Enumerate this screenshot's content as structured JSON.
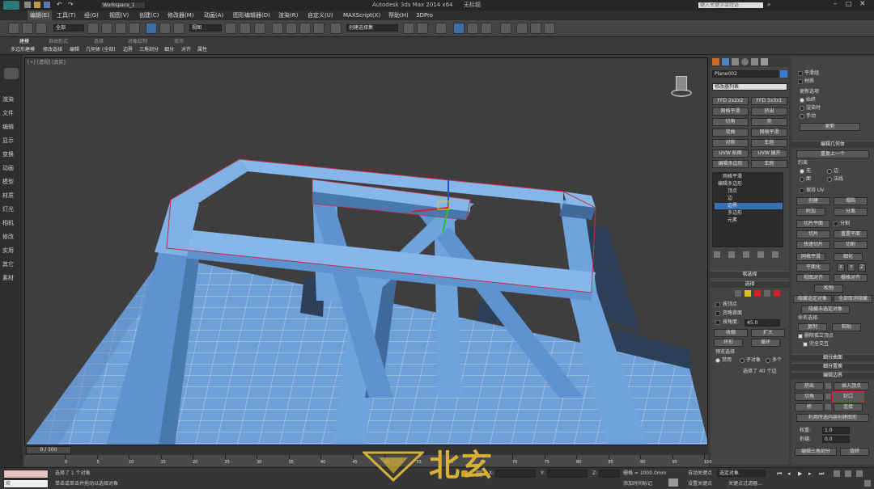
{
  "app": {
    "workspace": "Workspace_1",
    "title": "Autodesk 3ds Max 2014 x64",
    "filename": "无标题",
    "search_placeholder": "键入关键字或短语"
  },
  "menu": [
    "编辑(E)",
    "工具(T)",
    "组(G)",
    "视图(V)",
    "创建(C)",
    "修改器(M)",
    "动画(A)",
    "图形编辑器(D)",
    "渲染(R)",
    "自定义(U)",
    "MAXScript(X)",
    "帮助(H)",
    "3DPro"
  ],
  "toolbar": {
    "selection_filter": "全部",
    "view_dropdown": "视图",
    "named_selection": "创建选择集"
  },
  "ribbon": {
    "tabs": [
      "建模",
      "自由形式",
      "选择",
      "对象绘制",
      "填充"
    ],
    "subtabs": [
      "多边形建模",
      "修改选择",
      "编辑",
      "几何体 (全部)",
      "边界",
      "三角剖分",
      "细分",
      "对齐",
      "属性"
    ]
  },
  "command_bar": [
    "渲染",
    "文件",
    "编辑",
    "显示",
    "变换",
    "动画",
    "模型",
    "材质",
    "灯光",
    "相机",
    "修改",
    "实用",
    "其它",
    "素材"
  ],
  "viewport": {
    "label": "[+] [透视] [真实]"
  },
  "panel": {
    "object_name": "Plane002",
    "modifier_list": "修改器列表",
    "modifier_buttons": [
      "FFD 2x2x2",
      "FFD 3x3x1",
      "网格平滑",
      "挤出",
      "切角",
      "壳",
      "弯曲",
      "网格平滑",
      "对称",
      "车削",
      "UVW 贴图",
      "UVW 展开",
      "编辑多边形",
      "车削"
    ],
    "stack": [
      "网格平滑",
      "编辑多边形",
      "顶点",
      "边",
      "边界",
      "多边形",
      "元素"
    ],
    "soft_selection": "软选择",
    "selection_title": "选择",
    "by_vertex": "按顶点",
    "ignore_backfacing": "忽略背面",
    "by_angle": "按角度:",
    "angle_value": "45.0",
    "shrink": "收缩",
    "grow": "扩大",
    "ring": "环形",
    "loop": "循环",
    "preview_title": "预览选择",
    "preview_options": [
      "禁用",
      "子对象",
      "多个"
    ],
    "selection_status": "选择了 40 个边"
  },
  "panel2": {
    "smooth_group": "平滑组",
    "material_id": "材质",
    "update_title": "更新选项",
    "update_options": [
      "始终",
      "渲染时",
      "手动"
    ],
    "update_button": "更新",
    "edit_geometry": "编辑几何体",
    "repeat_last": "重复上一个",
    "constraint_title": "约束",
    "constraints": [
      "无",
      "边",
      "面",
      "法线"
    ],
    "keep_uv": "保持 UV",
    "create": "创建",
    "collapse": "塌陷",
    "attach": "附加",
    "detach": "分离",
    "slice_plane": "切片平面",
    "split": "分割",
    "slice": "切片",
    "reset_plane": "重置平面",
    "quick_slice": "快速切片",
    "cut": "切割",
    "meshsmooth": "网格平滑",
    "tessellate": "细化",
    "planarize": "平面化",
    "xyz": [
      "X",
      "Y",
      "Z"
    ],
    "view_align": "视图对齐",
    "grid_align": "栅格对齐",
    "relax": "松弛",
    "hide_selected": "隐藏选定对象",
    "unhide_all": "全部取消隐藏",
    "hide_unselected": "隐藏未选定对象",
    "named_sel": "命名选择:",
    "copy": "复制",
    "paste": "粘贴",
    "delete_isolated": "删除孤立顶点",
    "full_interactivity": "完全交互",
    "subdiv_surface": "细分曲面",
    "subdiv_displacement": "细分置换",
    "edit_borders": "编辑边界",
    "extrude": "挤出",
    "insert_vertex": "插入顶点",
    "chamfer": "切角",
    "cap": "封口",
    "bridge": "桥",
    "connect": "连接",
    "create_shape": "利用所选内容创建图形",
    "weight_label": "权重:",
    "weight_value": "1.0",
    "crease_label": "折缝:",
    "crease_value": "0.0",
    "edit_tri": "编辑三角剖分",
    "rotate": "旋转"
  },
  "timeline": {
    "frame": "0 / 100",
    "ticks": [
      "0",
      "5",
      "10",
      "15",
      "20",
      "25",
      "30",
      "35",
      "40",
      "45",
      "50",
      "55",
      "60",
      "65",
      "70",
      "75",
      "80",
      "85",
      "90",
      "95",
      "100"
    ]
  },
  "status": {
    "listener": "欢",
    "selected": "选择了 1 个对象",
    "prompt": "单击或单击并拖动以选择对象",
    "x_label": "X:",
    "y_label": "Y:",
    "z_label": "Z:",
    "grid": "栅格 = 1000.0mm",
    "auto_key": "自动关键点",
    "selected_obj": "选定对象",
    "set_key": "设置关键点",
    "key_filter": "关键点过滤器...",
    "add_time_tag": "添加时间标记"
  },
  "watermark": "北玄",
  "colors": {
    "mesh": "#6e9fd6",
    "mesh_dark": "#2f4560",
    "accent": "#d9b037"
  }
}
